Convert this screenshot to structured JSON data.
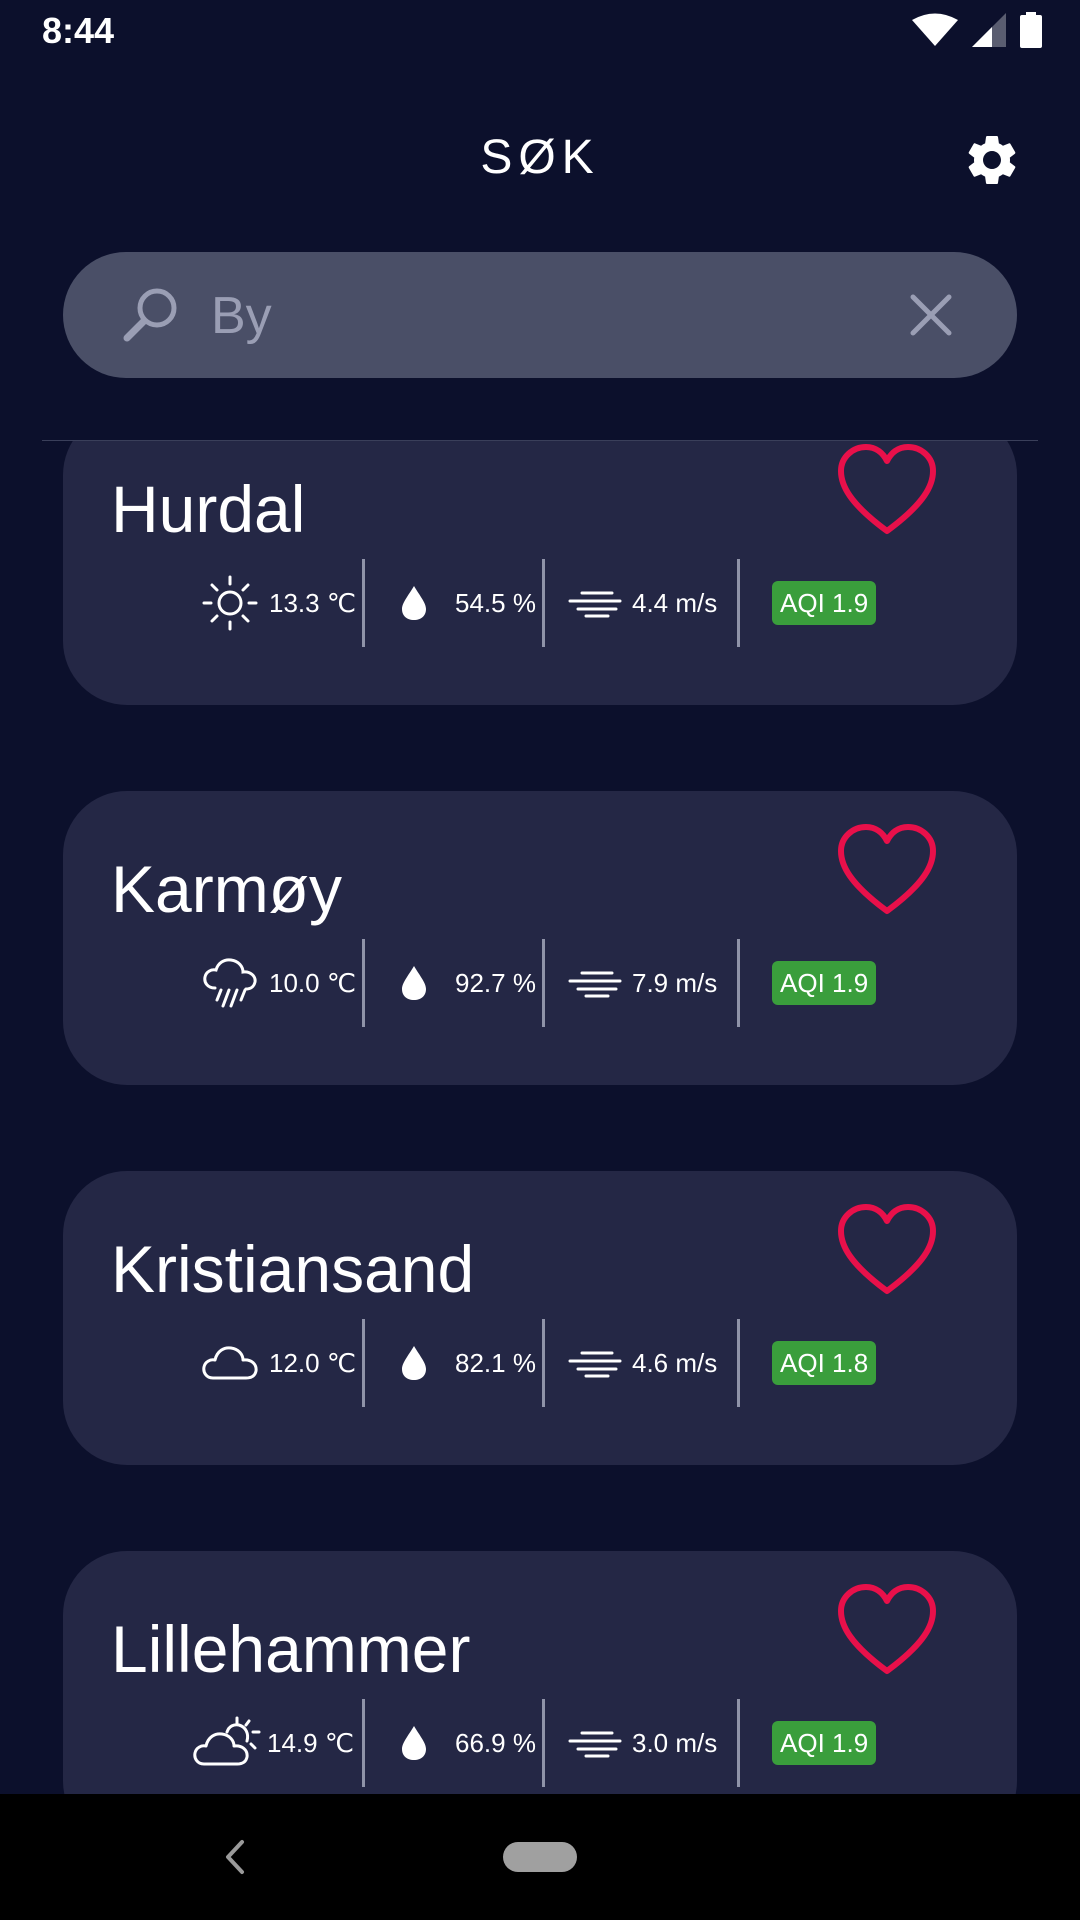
{
  "status_bar": {
    "time": "8:44"
  },
  "header": {
    "title": "SØK"
  },
  "search": {
    "placeholder": "By",
    "value": ""
  },
  "cities": [
    {
      "name": "Hurdal",
      "weather_icon": "sun-icon",
      "temperature": "13.3 ℃",
      "humidity": "54.5 %",
      "wind": "4.4 m/s",
      "aqi": "AQI 1.9"
    },
    {
      "name": "Karmøy",
      "weather_icon": "rain-cloud-icon",
      "temperature": "10.0 ℃",
      "humidity": "92.7 %",
      "wind": "7.9 m/s",
      "aqi": "AQI 1.9"
    },
    {
      "name": "Kristiansand",
      "weather_icon": "cloud-icon",
      "temperature": "12.0 ℃",
      "humidity": "82.1 %",
      "wind": "4.6 m/s",
      "aqi": "AQI 1.8"
    },
    {
      "name": "Lillehammer",
      "weather_icon": "partly-cloudy-icon",
      "temperature": "14.9 ℃",
      "humidity": "66.9 %",
      "wind": "3.0 m/s",
      "aqi": "AQI 1.9"
    }
  ],
  "colors": {
    "background": "#0c102c",
    "card": "#242745",
    "search_bar": "#4a4f67",
    "heart": "#e8104a",
    "aqi_good": "#3a9e3c"
  }
}
